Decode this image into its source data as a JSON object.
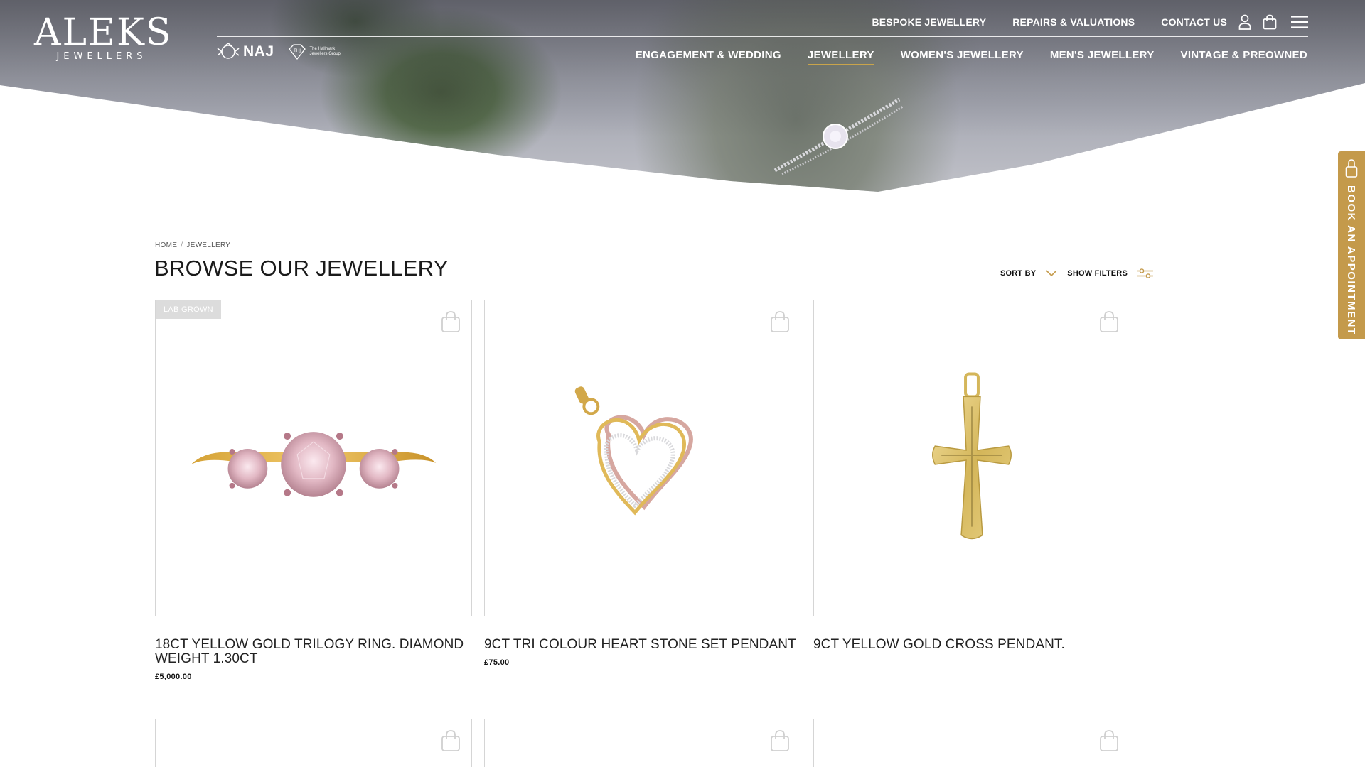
{
  "brand": {
    "logo_main": "ALEKS",
    "logo_sub": "JEWELLERS",
    "badge_naj": "NAJ",
    "badge_hallmark_line1": "The Hallmark",
    "badge_hallmark_line2": "Jewellers Group"
  },
  "top_nav": {
    "links": [
      "BESPOKE JEWELLERY",
      "REPAIRS & VALUATIONS",
      "CONTACT US"
    ],
    "icons": [
      "account-icon",
      "basket-icon",
      "menu-icon"
    ]
  },
  "main_nav": {
    "links": [
      "ENGAGEMENT & WEDDING",
      "JEWELLERY",
      "WOMEN'S JEWELLERY",
      "MEN'S JEWELLERY",
      "VINTAGE & PREOWNED"
    ],
    "active": "JEWELLERY"
  },
  "book_tab": {
    "label": "BOOK AN APPOINTMENT",
    "icon": "bag-icon"
  },
  "breadcrumb": {
    "home": "HOME",
    "separator": "/",
    "current": "JEWELLERY"
  },
  "page": {
    "title": "BROWSE OUR JEWELLERY"
  },
  "controls": {
    "sort_label": "SORT BY",
    "filters_label": "SHOW FILTERS"
  },
  "products": [
    {
      "badge": "LAB GROWN",
      "title": "18CT YELLOW GOLD TRILOGY RING. DIAMOND WEIGHT 1.30CT",
      "price": "£5,000.00",
      "image": "trilogy-ring"
    },
    {
      "badge": "",
      "title": "9CT TRI COLOUR HEART STONE SET PENDANT",
      "price": "£75.00",
      "image": "heart-pendant"
    },
    {
      "badge": "",
      "title": "9CT YELLOW GOLD CROSS PENDANT.",
      "price": "",
      "image": "cross-pendant"
    }
  ],
  "colors": {
    "accent_gold": "#c49a4b",
    "active_underline": "#c9a44b",
    "border": "#d5d5d5",
    "badge_bg": "#dcdcdc"
  }
}
